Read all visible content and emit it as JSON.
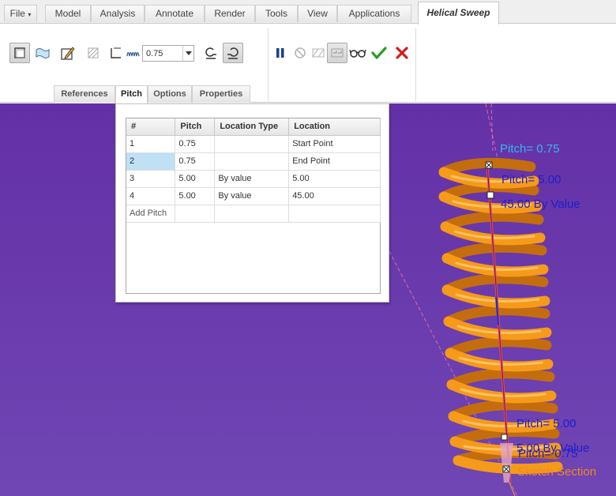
{
  "ribbon": {
    "file_menu": "File",
    "tabs": [
      "Model",
      "Analysis",
      "Annotate",
      "Render",
      "Tools",
      "View",
      "Applications"
    ],
    "active_tab": "Helical Sweep"
  },
  "toolbar": {
    "pitch_value": "0.75"
  },
  "subtabs": [
    {
      "label": "References"
    },
    {
      "label": "Pitch"
    },
    {
      "label": "Options"
    },
    {
      "label": "Properties"
    }
  ],
  "pitch_table": {
    "headers": [
      "#",
      "Pitch",
      "Location Type",
      "Location"
    ],
    "rows": [
      {
        "num": "1",
        "pitch": "0.75",
        "location_type": "",
        "location": "Start Point"
      },
      {
        "num": "2",
        "pitch": "0.75",
        "location_type": "",
        "location": "End Point"
      },
      {
        "num": "3",
        "pitch": "5.00",
        "location_type": "By value",
        "location": "5.00"
      },
      {
        "num": "4",
        "pitch": "5.00",
        "location_type": "By value",
        "location": "45.00"
      }
    ],
    "add_row_label": "Add Pitch"
  },
  "viewport_labels": {
    "top_pitch": "Pitch= 0.75",
    "upper_pitch": "Pitch= 5.00",
    "upper_value": "45.00 By Value",
    "lower_pitch": "Pitch= 5.00",
    "lower_value": "5.00 By Value",
    "bottom_pitch": "Pitch= 0.75",
    "section_label": "Sketch Section"
  },
  "colors": {
    "viewport_top": "#6430a6",
    "viewport_bottom": "#7046b4",
    "spring": "#f59a1a",
    "label_cyan": "#35b8ee",
    "label_blue": "#1c1ed0",
    "label_orange": "#f08a20",
    "confirm_green": "#2a9b2a",
    "cancel_red": "#d21c1c"
  }
}
